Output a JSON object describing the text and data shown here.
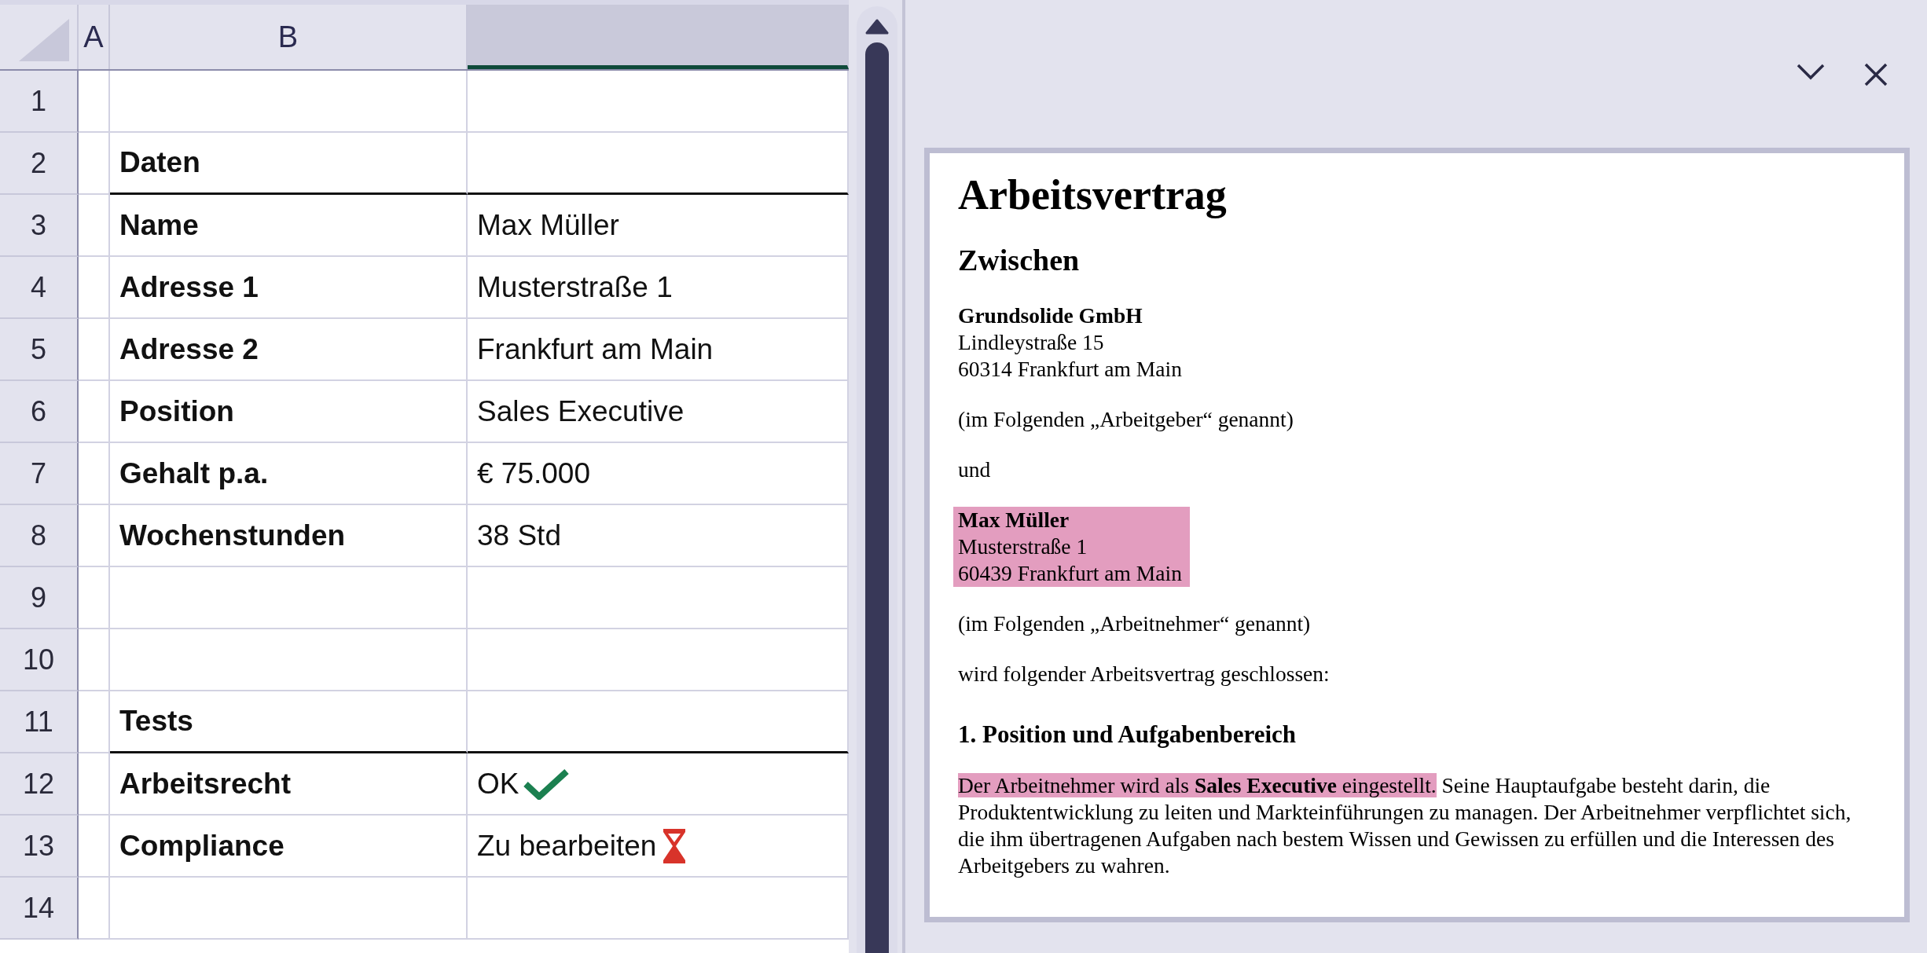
{
  "sheet": {
    "columns": [
      {
        "label": "A",
        "selected": false
      },
      {
        "label": "B",
        "selected": false
      },
      {
        "selected": true
      }
    ],
    "rows": [
      {
        "number": "1",
        "kind": "empty"
      },
      {
        "number": "2",
        "kind": "section",
        "label": "Daten"
      },
      {
        "number": "3",
        "kind": "field",
        "label": "Name",
        "value": "Max Müller"
      },
      {
        "number": "4",
        "kind": "field",
        "label": "Adresse 1",
        "value": "Musterstraße 1"
      },
      {
        "number": "5",
        "kind": "field",
        "label": "Adresse 2",
        "value": "Frankfurt am Main"
      },
      {
        "number": "6",
        "kind": "field",
        "label": "Position",
        "value": "Sales Executive"
      },
      {
        "number": "7",
        "kind": "field",
        "label": "Gehalt p.a.",
        "value": "€ 75.000"
      },
      {
        "number": "8",
        "kind": "field",
        "label": "Wochenstunden",
        "value": "38 Std"
      },
      {
        "number": "9",
        "kind": "empty"
      },
      {
        "number": "10",
        "kind": "empty"
      },
      {
        "number": "11",
        "kind": "section",
        "label": "Tests"
      },
      {
        "number": "12",
        "kind": "field",
        "label": "Arbeitsrecht",
        "value": "OK",
        "icon": {
          "kind": "checkmark"
        }
      },
      {
        "number": "13",
        "kind": "field",
        "label": "Compliance",
        "value": "Zu bearbeiten",
        "icon": {
          "kind": "hourglass"
        }
      },
      {
        "number": "14",
        "kind": "empty"
      }
    ]
  },
  "document": {
    "blocks": [
      {
        "kind": "title",
        "text": "Arbeitsvertrag"
      },
      {
        "kind": "heading",
        "text": "Zwischen"
      },
      {
        "kind": "party",
        "highlighted": false,
        "lines": [
          "Grundsolide GmbH",
          "Lindleystraße 15",
          "60314 Frankfurt am Main"
        ]
      },
      {
        "kind": "paragraph",
        "segments": [
          {
            "text": "(im Folgenden „Arbeitgeber“ genannt)",
            "highlighted": false
          }
        ]
      },
      {
        "kind": "paragraph",
        "segments": [
          {
            "text": "und",
            "highlighted": false
          }
        ]
      },
      {
        "kind": "party",
        "highlighted": true,
        "lines": [
          "Max Müller",
          "Musterstraße 1",
          "60439 Frankfurt am Main"
        ]
      },
      {
        "kind": "paragraph",
        "segments": [
          {
            "text": "(im Folgenden „Arbeitnehmer“ genannt)",
            "highlighted": false
          }
        ]
      },
      {
        "kind": "paragraph",
        "segments": [
          {
            "text": "wird folgender Arbeitsvertrag geschlossen:",
            "highlighted": false
          }
        ]
      },
      {
        "kind": "subheading",
        "text": "1. Position und Aufgabenbereich"
      },
      {
        "kind": "paragraph",
        "segments": [
          {
            "text": "Der Arbeitnehmer wird als **Sales Executive** eingestellt.",
            "highlighted": true
          },
          {
            "text": " Seine Hauptaufgabe besteht darin, die Produktentwicklung zu leiten und Markteinführungen zu managen. Der Arbeitnehmer verpflichtet sich, die ihm übertragenen Aufgaben nach bestem Wissen und Gewissen zu erfüllen und die Interessen des Arbeitgebers zu wahren.",
            "highlighted": false
          }
        ]
      }
    ]
  }
}
